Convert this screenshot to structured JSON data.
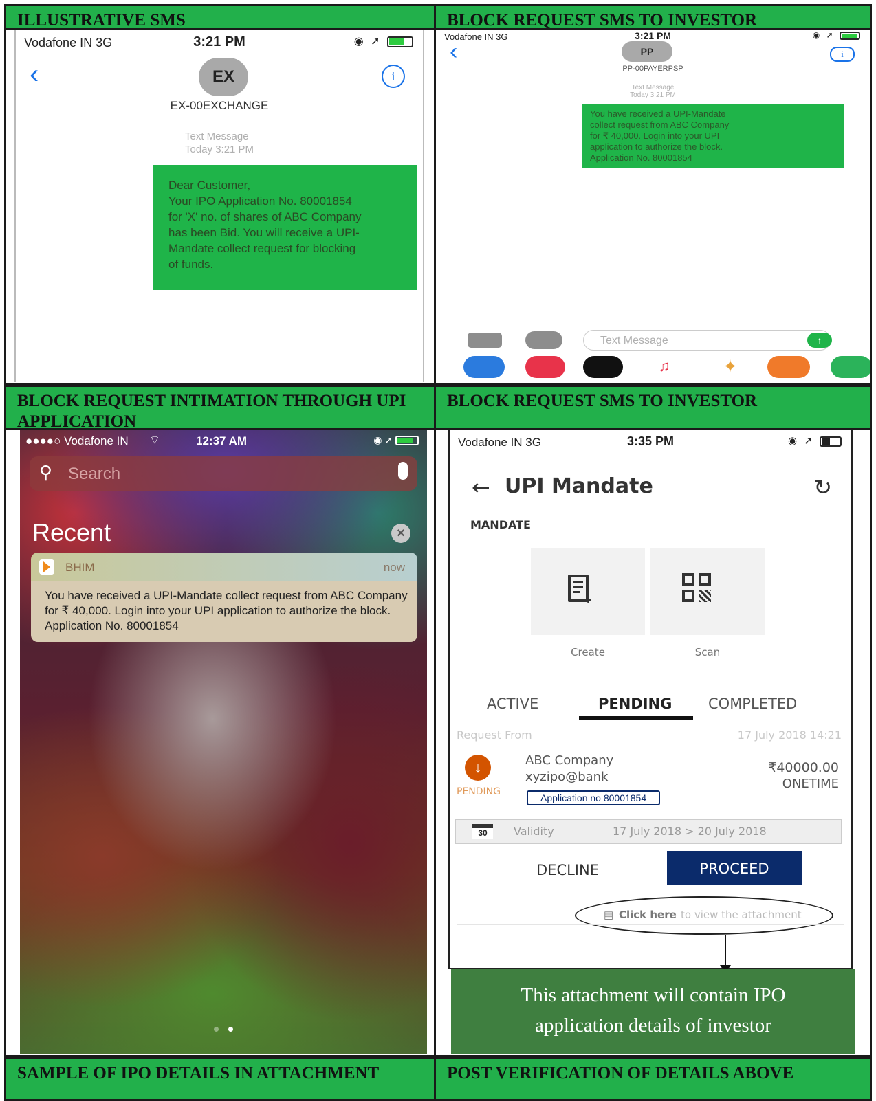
{
  "headers": {
    "q1": "ILLUSTRATIVE SMS",
    "q2": "BLOCK REQUEST SMS TO INVESTOR",
    "q3": "BLOCK REQUEST INTIMATION THROUGH UPI APPLICATION",
    "q4": "BLOCK REQUEST SMS TO INVESTOR",
    "q5": "SAMPLE OF IPO DETAILS IN ATTACHMENT",
    "q6": "POST VERIFICATION OF DETAILS ABOVE"
  },
  "sms1": {
    "carrier": "Vodafone IN  3G",
    "time": "3:21 PM",
    "avatar": "EX",
    "sender": "EX-00EXCHANGE",
    "meta_type": "Text Message",
    "meta_time": "Today 3:21 PM",
    "message_lines": [
      "Dear Customer,",
      "Your IPO Application No. 80001854",
      "for 'X' no. of shares of ABC Company",
      "has been Bid. You will receive a UPI-",
      "Mandate collect request for blocking",
      "of funds."
    ]
  },
  "sms2": {
    "carrier": "Vodafone IN  3G",
    "time": "3:21 PM",
    "avatar": "PP",
    "sender": "PP-00PAYERPSP",
    "meta_type": "Text Message",
    "meta_time": "Today 3:21 PM",
    "message_lines": [
      "You have received a UPI-Mandate",
      "collect request from ABC Company",
      "for ₹ 40,000. Login into your UPI",
      "application to authorize the block.",
      "Application No. 80001854"
    ],
    "compose_placeholder": "Text Message"
  },
  "notif": {
    "carrier": "●●●●○ Vodafone IN",
    "time": "12:37 AM",
    "search_placeholder": "Search",
    "recent_label": "Recent",
    "app_name": "BHIM",
    "when": "now",
    "body": "You have received a UPI-Mandate collect request from ABC Company for ₹ 40,000. Login into your UPI application to authorize the block. Application No. 80001854"
  },
  "mandate": {
    "carrier": "Vodafone IN  3G",
    "time": "3:35 PM",
    "title": "UPI Mandate",
    "section": "MANDATE",
    "create_label": "Create",
    "scan_label": "Scan",
    "tabs": [
      "ACTIVE",
      "PENDING",
      "COMPLETED"
    ],
    "request_from_label": "Request From",
    "request_date": "17 July 2018 14:21",
    "payee_name": "ABC Company",
    "payee_vpa": "xyzipo@bank",
    "amount": "₹40000.00",
    "frequency": "ONETIME",
    "status": "PENDING",
    "application_no": "Application no 80001854",
    "calendar_day": "30",
    "validity_label": "Validity",
    "validity_range": "17 July 2018 > 20 July 2018",
    "decline_label": "DECLINE",
    "proceed_label": "PROCEED",
    "click_here": "Click here",
    "view_attachment": " to view the attachment",
    "callout_line1": "This attachment will contain IPO",
    "callout_line2": "application details of investor"
  },
  "colors": {
    "header_green": "#22b04b",
    "bubble_green": "#1fb449",
    "proceed_blue": "#0b2b6b",
    "pending_orange": "#d35400",
    "callout_green": "#3f7f40"
  }
}
